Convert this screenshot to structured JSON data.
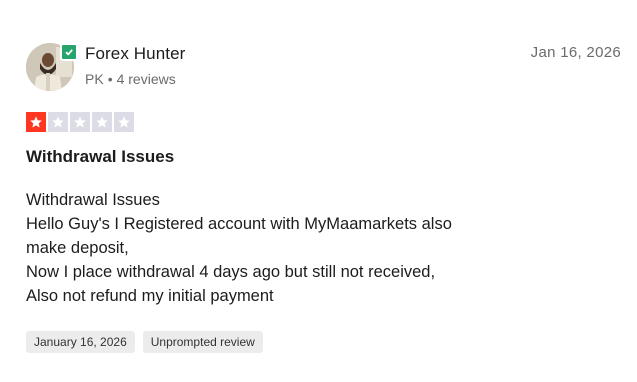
{
  "reviewer": {
    "name": "Forex Hunter",
    "country": "PK",
    "separator": "•",
    "review_count": "4 reviews",
    "verified_color": "#27a46b"
  },
  "review_date": "Jan 16, 2026",
  "rating": {
    "value": 1,
    "max": 5,
    "active_color": "#ff3722",
    "inactive_color": "#dcdce6"
  },
  "title": "Withdrawal Issues",
  "body_lines": [
    "Withdrawal Issues",
    "Hello Guy's I Registered account with MyMaamarkets also",
    "make deposit,",
    "Now I place withdrawal 4 days ago but still not received,",
    "Also not refund my initial payment"
  ],
  "tags": {
    "experience_date": "January 16, 2026",
    "review_type": "Unprompted review"
  },
  "icons": {
    "avatar": "reviewer-avatar",
    "verified": "verified-check-icon",
    "star": "star-icon"
  }
}
